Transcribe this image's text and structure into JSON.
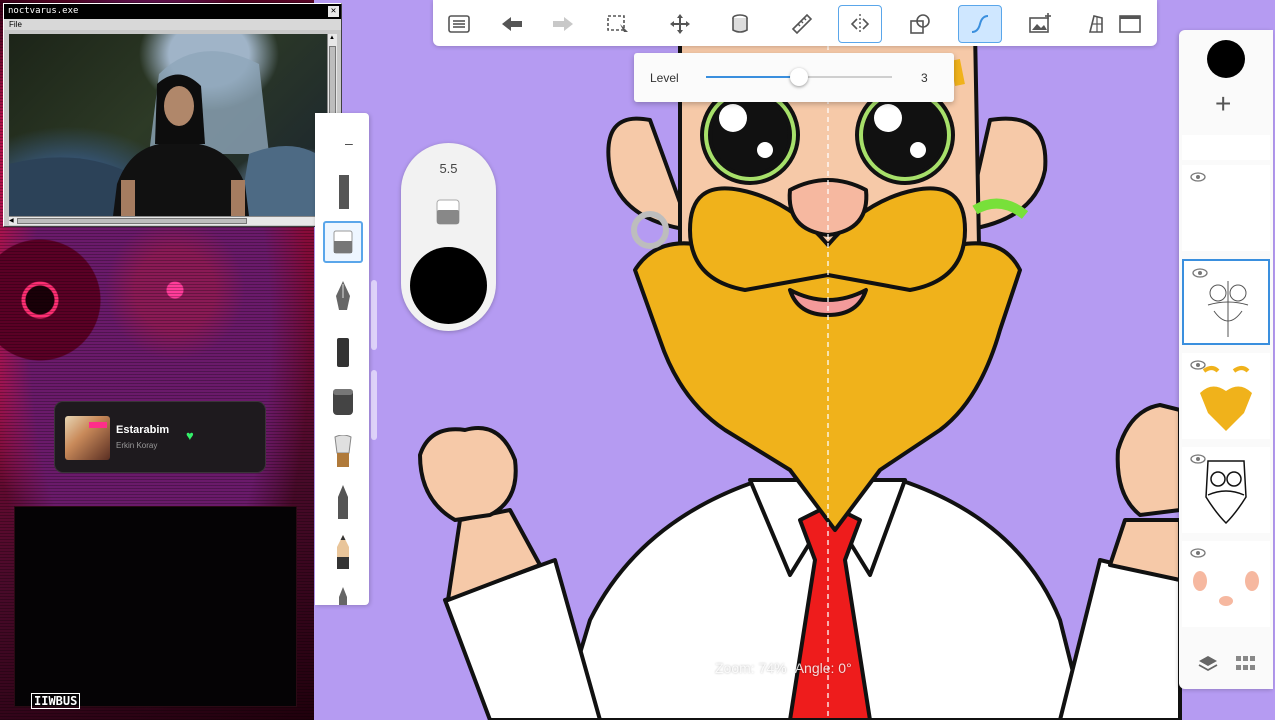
{
  "desktop": {
    "window": {
      "title": "noctvarus.exe",
      "close_label": "✕",
      "menu": "File"
    },
    "music": {
      "title": "Estarabim",
      "artist": "Erkin Koray",
      "liked_icon": "heart-icon"
    },
    "logo": "IIWBUS"
  },
  "toolbar": {
    "items": [
      {
        "name": "menu-list-button",
        "icon": "list-icon"
      },
      {
        "name": "undo-button",
        "icon": "undo-arrow-icon"
      },
      {
        "name": "redo-button",
        "icon": "redo-arrow-icon"
      },
      {
        "name": "selection-button",
        "icon": "select-rect-icon"
      },
      {
        "name": "transform-button",
        "icon": "move-icon"
      },
      {
        "name": "fill-button",
        "icon": "bucket-icon"
      },
      {
        "name": "ruler-button",
        "icon": "ruler-icon"
      },
      {
        "name": "symmetry-button",
        "icon": "symmetry-icon"
      },
      {
        "name": "shapes-button",
        "icon": "shapes-icon"
      },
      {
        "name": "stroke-button",
        "icon": "curve-stroke-icon"
      },
      {
        "name": "add-image-button",
        "icon": "add-image-icon"
      },
      {
        "name": "perspective-button",
        "icon": "perspective-icon"
      },
      {
        "name": "fullscreen-button",
        "icon": "window-icon"
      }
    ]
  },
  "level": {
    "label": "Level",
    "value": "3",
    "fraction": 0.5
  },
  "brush": {
    "size": "5.5",
    "current_color": "#000000"
  },
  "layers": {
    "color": "#000000",
    "add_label": "+"
  },
  "status": {
    "zoom": "Zoom: 74%",
    "angle": "Angle: 0°"
  },
  "colors": {
    "background": "#b59bf2",
    "accent": "#3a8fde",
    "beard": "#f0b21b",
    "tie": "#ee1c1c"
  }
}
